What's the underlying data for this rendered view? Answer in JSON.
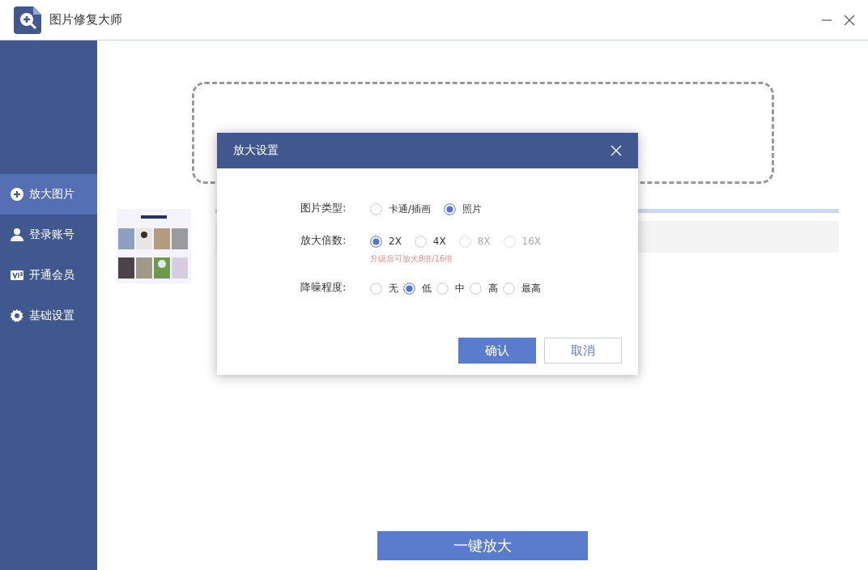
{
  "window": {
    "title": "图片修复大师"
  },
  "sidebar": {
    "items": [
      {
        "label": "放大图片",
        "selected": true
      },
      {
        "label": "登录账号",
        "selected": false
      },
      {
        "label": "开通会员",
        "selected": false
      },
      {
        "label": "基础设置",
        "selected": false
      }
    ]
  },
  "start_button": "一键放大",
  "dialog": {
    "title": "放大设置",
    "groups": [
      {
        "label": "图片类型:",
        "options": [
          {
            "label": "卡通/插画",
            "selected": false,
            "disabled": false
          },
          {
            "label": "照片",
            "selected": true,
            "disabled": false
          }
        ]
      },
      {
        "label": "放大倍数:",
        "options": [
          {
            "label": "2X",
            "selected": true,
            "disabled": false
          },
          {
            "label": "4X",
            "selected": false,
            "disabled": false
          },
          {
            "label": "8X",
            "selected": false,
            "disabled": true
          },
          {
            "label": "16X",
            "selected": false,
            "disabled": true
          }
        ],
        "hint": "升级后可放大8倍/16倍"
      },
      {
        "label": "降噪程度:",
        "options": [
          {
            "label": "无",
            "selected": false,
            "disabled": false
          },
          {
            "label": "低",
            "selected": true,
            "disabled": false
          },
          {
            "label": "中",
            "selected": false,
            "disabled": false
          },
          {
            "label": "高",
            "selected": false,
            "disabled": false
          },
          {
            "label": "最高",
            "selected": false,
            "disabled": false
          }
        ]
      }
    ],
    "confirm": "确认",
    "cancel": "取消"
  }
}
